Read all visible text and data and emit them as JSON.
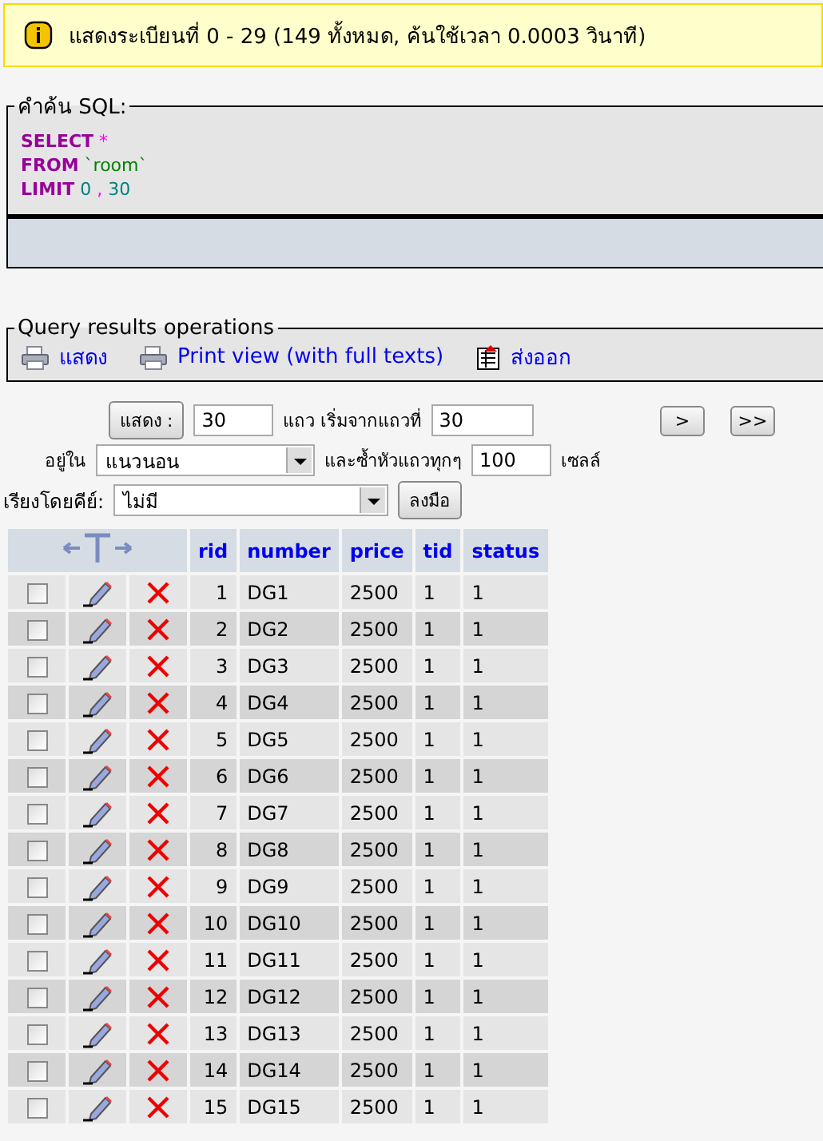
{
  "notice": {
    "text": "แสดงระเบียนที่ 0 - 29 (149 ทั้งหมด, ค้นใช้เวลา 0.0003 วินาที)"
  },
  "sql_box": {
    "legend": "คำค้น SQL:",
    "lines": [
      [
        {
          "kind": "keyword",
          "text": "SELECT"
        },
        {
          "kind": "operator",
          "text": "*"
        }
      ],
      [
        {
          "kind": "keyword",
          "text": "FROM"
        },
        {
          "kind": "identifier",
          "text": "`room`"
        }
      ],
      [
        {
          "kind": "keyword",
          "text": "LIMIT"
        },
        {
          "kind": "number",
          "text": "0"
        },
        {
          "kind": "operator",
          "text": ","
        },
        {
          "kind": "number",
          "text": "30"
        }
      ]
    ]
  },
  "operations": {
    "legend": "Query results operations",
    "links": [
      {
        "kind": "print",
        "label": "แสดง"
      },
      {
        "kind": "print",
        "label": "Print view (with full texts)"
      },
      {
        "kind": "export",
        "label": "ส่งออก"
      }
    ]
  },
  "navigation": {
    "show_button": "แสดง :",
    "rows_value": "30",
    "rows_label": "แถว เริ่มจากแถวที่",
    "start_value": "30",
    "next_button": ">",
    "last_button": ">>",
    "mode_label": "อยู่ใน",
    "mode_value": "แนวนอน",
    "repeat_label": "และซ้ำหัวแถวทุกๆ",
    "repeat_value": "100",
    "cells_label": "เซลล์",
    "sort_label": "เรียงโดยคีย์:",
    "sort_value": "ไม่มี",
    "go_button": "ลงมือ"
  },
  "table": {
    "columns": [
      "rid",
      "number",
      "price",
      "tid",
      "status"
    ],
    "rows": [
      {
        "checked": false,
        "cells": [
          "1",
          "DG1",
          "2500",
          "1",
          "1"
        ]
      },
      {
        "checked": false,
        "cells": [
          "2",
          "DG2",
          "2500",
          "1",
          "1"
        ]
      },
      {
        "checked": false,
        "cells": [
          "3",
          "DG3",
          "2500",
          "1",
          "1"
        ]
      },
      {
        "checked": false,
        "cells": [
          "4",
          "DG4",
          "2500",
          "1",
          "1"
        ]
      },
      {
        "checked": false,
        "cells": [
          "5",
          "DG5",
          "2500",
          "1",
          "1"
        ]
      },
      {
        "checked": false,
        "cells": [
          "6",
          "DG6",
          "2500",
          "1",
          "1"
        ]
      },
      {
        "checked": false,
        "cells": [
          "7",
          "DG7",
          "2500",
          "1",
          "1"
        ]
      },
      {
        "checked": false,
        "cells": [
          "8",
          "DG8",
          "2500",
          "1",
          "1"
        ]
      },
      {
        "checked": false,
        "cells": [
          "9",
          "DG9",
          "2500",
          "1",
          "1"
        ]
      },
      {
        "checked": false,
        "cells": [
          "10",
          "DG10",
          "2500",
          "1",
          "1"
        ]
      },
      {
        "checked": false,
        "cells": [
          "11",
          "DG11",
          "2500",
          "1",
          "1"
        ]
      },
      {
        "checked": false,
        "cells": [
          "12",
          "DG12",
          "2500",
          "1",
          "1"
        ]
      },
      {
        "checked": false,
        "cells": [
          "13",
          "DG13",
          "2500",
          "1",
          "1"
        ]
      },
      {
        "checked": false,
        "cells": [
          "14",
          "DG14",
          "2500",
          "1",
          "1"
        ]
      },
      {
        "checked": false,
        "cells": [
          "15",
          "DG15",
          "2500",
          "1",
          "1"
        ]
      }
    ]
  }
}
